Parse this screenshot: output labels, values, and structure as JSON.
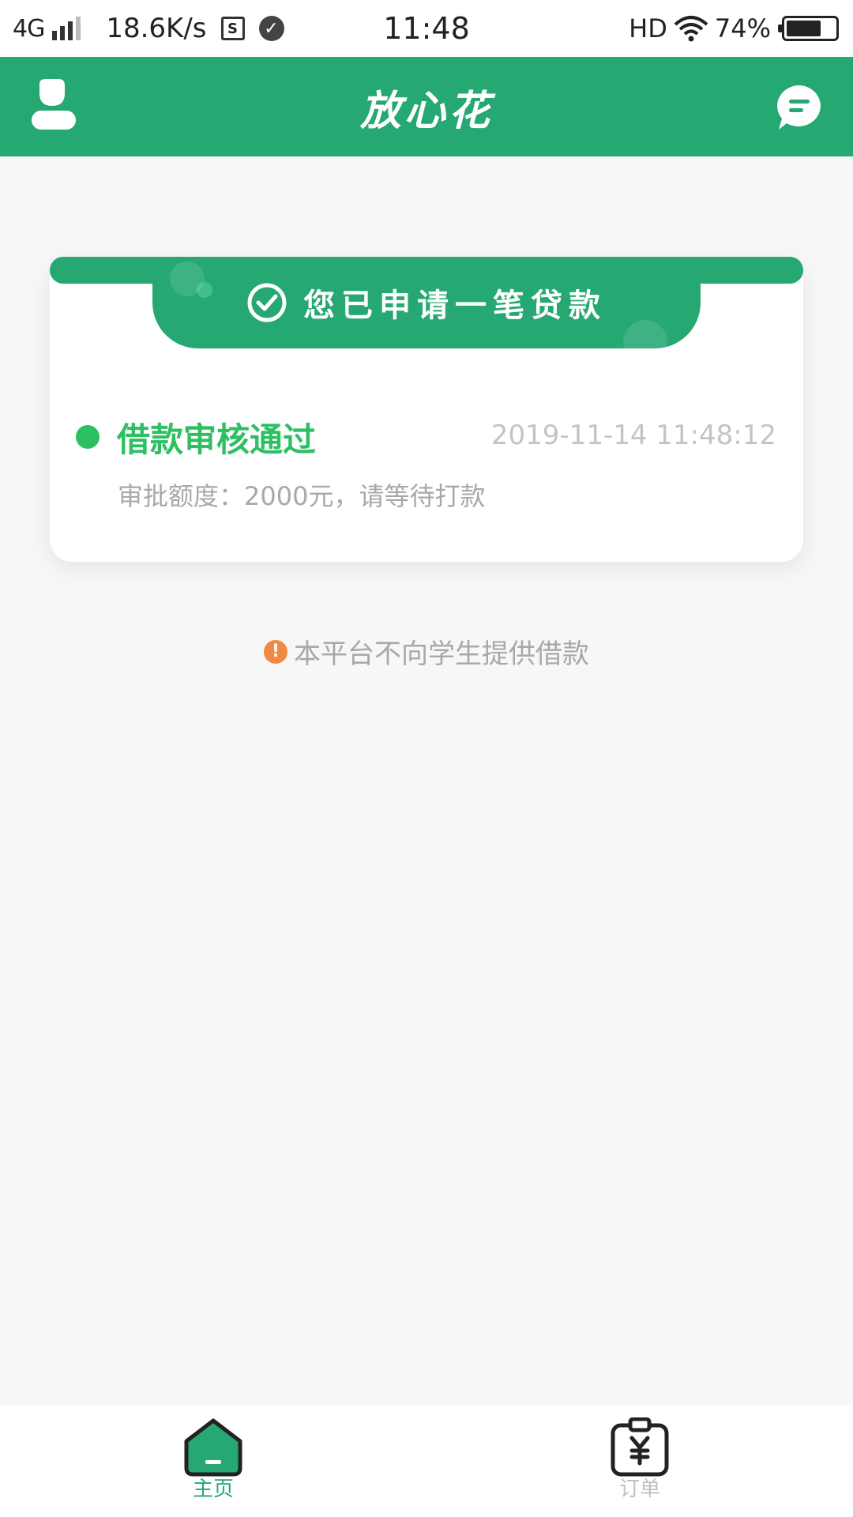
{
  "status_bar": {
    "network": "4G",
    "speed": "18.6K/s",
    "sim_label": "S",
    "time": "11:48",
    "hd": "HD",
    "battery_percent": "74%",
    "battery_level": 0.74
  },
  "header": {
    "title": "放心花",
    "left_icon": "user-icon",
    "right_icon": "message-icon"
  },
  "card": {
    "banner_text": "您已申请一笔贷款",
    "status_title": "借款审核通过",
    "status_time": "2019-11-14 11:48:12",
    "status_desc": "审批额度：2000元，请等待打款"
  },
  "notice": {
    "icon": "!",
    "text": "本平台不向学生提供借款"
  },
  "bottom_nav": {
    "items": [
      {
        "label": "主页",
        "icon": "home-icon",
        "active": true
      },
      {
        "label": "订单",
        "icon": "order-icon",
        "active": false
      }
    ]
  },
  "colors": {
    "brand_green": "#25a872",
    "status_green": "#2fbf63",
    "notice_orange": "#f08a43",
    "muted_text": "#a8a8a8"
  }
}
